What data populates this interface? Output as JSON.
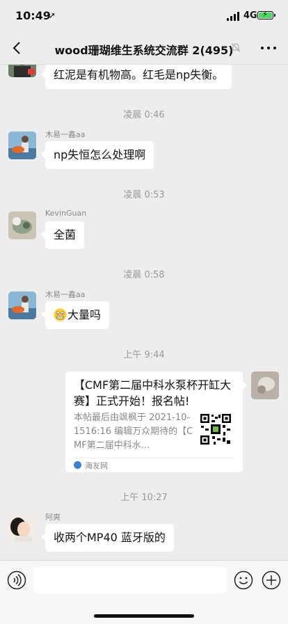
{
  "status_bar": {
    "time": "10:49",
    "network": "4G"
  },
  "nav": {
    "title": "wood珊瑚维生系统交流群 2(495)"
  },
  "messages": [
    {
      "text": "红泥是有机物高。红毛是np失衡。"
    },
    {
      "time": "凌晨 0:46"
    },
    {
      "sender": "木易一鑫aa",
      "text": "np失恒怎么处理啊"
    },
    {
      "time": "凌晨 0:53"
    },
    {
      "sender": "KevinGuan",
      "text": "全菌"
    },
    {
      "time": "凌晨 0:58"
    },
    {
      "sender": "木易一鑫aa",
      "text": "大量吗",
      "emoji": "grimace-emoji"
    },
    {
      "time": "上午 9:44"
    },
    {
      "card": {
        "title": "【CMF第二届中科水泵杯开缸大赛】正式开始！报名帖!",
        "desc": "本帖最后由飒枫于 2021-10-1516:16 编辑万众期待的【CMF第二届中科水...",
        "source": "海友网"
      }
    },
    {
      "time": "上午 10:27"
    },
    {
      "sender": "阿爽",
      "text": "收两个MP40 蓝牙版的"
    }
  ],
  "icons": {
    "back": "chevron-left-icon",
    "mute": "bell-off-icon",
    "more": "more-dots-icon",
    "voice": "voice-icon",
    "emoji": "smile-icon",
    "plus": "plus-circle-icon"
  },
  "colors": {
    "background": "#ededed",
    "bubble": "#ffffff",
    "battery": "#4cd964"
  }
}
